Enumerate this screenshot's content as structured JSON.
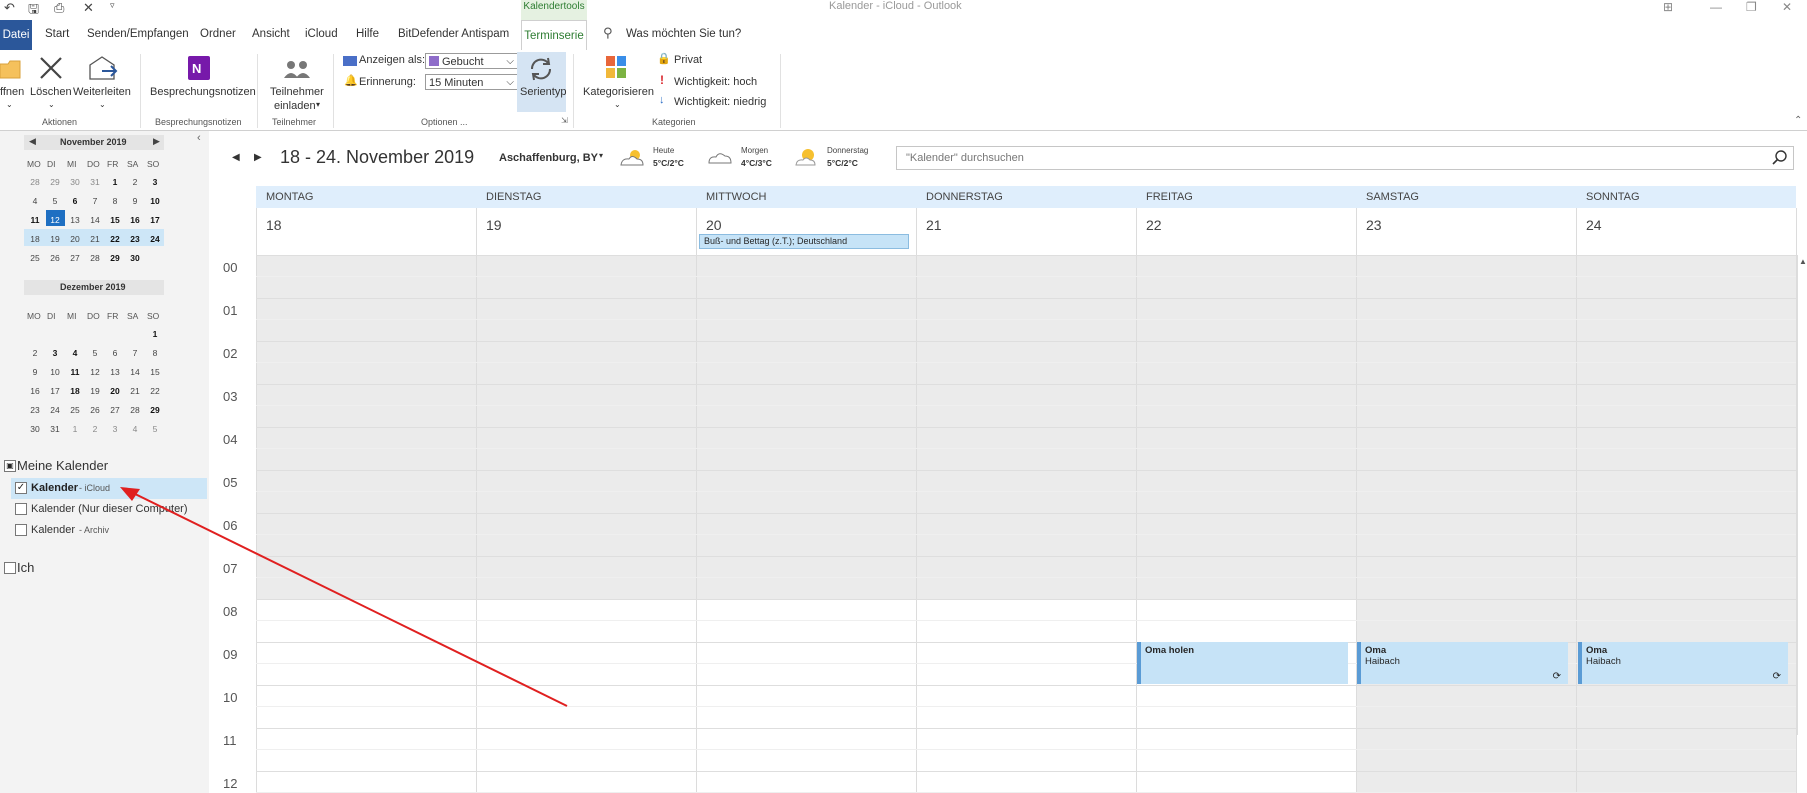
{
  "titlebar": {
    "context_tab_group": "Kalendertools",
    "window_title": "Kalender - iCloud  -  Outlook"
  },
  "tabs": [
    "Datei",
    "Start",
    "Senden/Empfangen",
    "Ordner",
    "Ansicht",
    "iCloud",
    "Hilfe",
    "BitDefender Antispam",
    "Terminserie"
  ],
  "tell_me": "Was möchten Sie tun?",
  "ribbon": {
    "actions": {
      "open": "ffnen",
      "delete": "Löschen",
      "forward": "Weiterleiten",
      "group": "Aktionen"
    },
    "meeting_notes": {
      "label": "Besprechungsnotizen",
      "group": "Besprechungsnotizen"
    },
    "attendees": {
      "label1": "Teilnehmer",
      "label2": "einladen",
      "group": "Teilnehmer"
    },
    "options": {
      "show_as_label": "Anzeigen als:",
      "show_as_value": "Gebucht",
      "reminder_label": "Erinnerung:",
      "reminder_value": "15 Minuten",
      "recurrence": "Serientyp",
      "group": "Optionen ..."
    },
    "tags": {
      "categorize": "Kategorisieren",
      "private": "Privat",
      "high": "Wichtigkeit: hoch",
      "low": "Wichtigkeit: niedrig",
      "group": "Kategorien"
    }
  },
  "mini_calendars": [
    {
      "title": "November 2019",
      "headers": [
        "MO",
        "DI",
        "MI",
        "DO",
        "FR",
        "SA",
        "SO"
      ],
      "weeks": [
        [
          "28",
          "29",
          "30",
          "31",
          "1",
          "2",
          "3"
        ],
        [
          "4",
          "5",
          "6",
          "7",
          "8",
          "9",
          "10"
        ],
        [
          "11",
          "12",
          "13",
          "14",
          "15",
          "16",
          "17"
        ],
        [
          "18",
          "19",
          "20",
          "21",
          "22",
          "23",
          "24"
        ],
        [
          "25",
          "26",
          "27",
          "28",
          "29",
          "30",
          ""
        ]
      ]
    },
    {
      "title": "Dezember 2019",
      "headers": [
        "MO",
        "DI",
        "MI",
        "DO",
        "FR",
        "SA",
        "SO"
      ],
      "weeks": [
        [
          "",
          "",
          "",
          "",
          "",
          "",
          "1"
        ],
        [
          "2",
          "3",
          "4",
          "5",
          "6",
          "7",
          "8"
        ],
        [
          "9",
          "10",
          "11",
          "12",
          "13",
          "14",
          "15"
        ],
        [
          "16",
          "17",
          "18",
          "19",
          "20",
          "21",
          "22"
        ],
        [
          "23",
          "24",
          "25",
          "26",
          "27",
          "28",
          "29"
        ],
        [
          "30",
          "31",
          "1",
          "2",
          "3",
          "4",
          "5"
        ]
      ]
    }
  ],
  "folders": {
    "my_calendars": "Meine Kalender",
    "items": [
      {
        "name": "Kalender",
        "suffix": "- iCloud",
        "checked": true
      },
      {
        "name": "Kalender (Nur dieser Computer)",
        "suffix": "",
        "checked": false
      },
      {
        "name": "Kalender",
        "suffix": "- Archiv",
        "checked": false
      }
    ],
    "ich": "Ich"
  },
  "calendar": {
    "range": "18 - 24. November 2019",
    "location": "Aschaffenburg, BY",
    "weather": [
      {
        "day": "Heute",
        "temp": "5°C/2°C"
      },
      {
        "day": "Morgen",
        "temp": "4°C/3°C"
      },
      {
        "day": "Donnerstag",
        "temp": "5°C/2°C"
      }
    ],
    "search_placeholder": "\"Kalender\" durchsuchen",
    "days": [
      {
        "name": "MONTAG",
        "num": "18"
      },
      {
        "name": "DIENSTAG",
        "num": "19"
      },
      {
        "name": "MITTWOCH",
        "num": "20"
      },
      {
        "name": "DONNERSTAG",
        "num": "21"
      },
      {
        "name": "FREITAG",
        "num": "22"
      },
      {
        "name": "SAMSTAG",
        "num": "23"
      },
      {
        "name": "SONNTAG",
        "num": "24"
      }
    ],
    "hours": [
      "00",
      "01",
      "02",
      "03",
      "04",
      "05",
      "06",
      "07",
      "08",
      "09",
      "10",
      "11",
      "12"
    ],
    "allday_event": "Buß- und Bettag (z.T.); Deutschland",
    "appointments": [
      {
        "title": "Oma holen",
        "location": ""
      },
      {
        "title": "Oma",
        "location": "Haibach"
      },
      {
        "title": "Oma",
        "location": "Haibach"
      }
    ]
  },
  "colors": {
    "accent": "#2b579a",
    "appointment": "#c6e3f7",
    "arrow": "#e02020"
  }
}
